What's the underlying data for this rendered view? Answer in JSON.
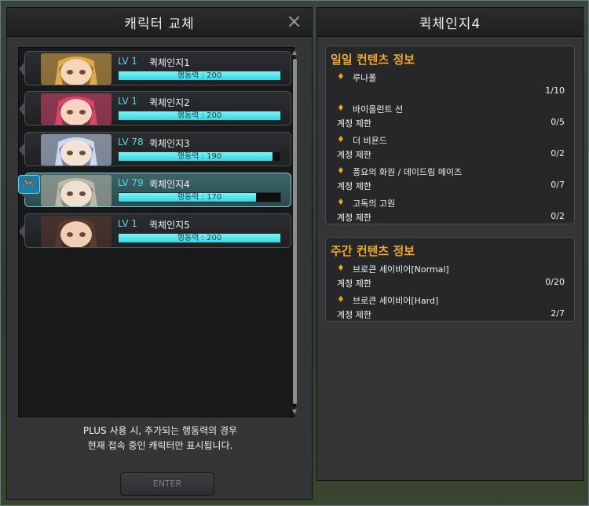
{
  "left_panel": {
    "title": "캐릭터 교체",
    "close_icon": "×",
    "characters": [
      {
        "level": "LV 1",
        "name": "퀵체인지1",
        "stamina": "행동력 : 200",
        "fill": 1.0,
        "hair": "#e0a94a",
        "skin": "#f5d6b8"
      },
      {
        "level": "LV 1",
        "name": "퀵체인지2",
        "stamina": "행동력 : 200",
        "fill": 1.0,
        "hair": "#d9446a",
        "skin": "#f7d4c0"
      },
      {
        "level": "LV 78",
        "name": "퀵체인지3",
        "stamina": "행동력 : 190",
        "fill": 0.95,
        "hair": "#c9d9f2",
        "skin": "#f3e2d6"
      },
      {
        "level": "LV 79",
        "name": "퀵체인지4",
        "stamina": "행동력 : 170",
        "fill": 0.85,
        "hair": "#bdb7a8",
        "skin": "#efe1d0"
      },
      {
        "level": "LV 1",
        "name": "퀵체인지5",
        "stamina": "행동력 : 200",
        "fill": 1.0,
        "hair": "#5a3a2c",
        "skin": "#f0cfb4"
      }
    ],
    "notice_line1": "PLUS 사용 시, 추가되는 행동력의 경우",
    "notice_line2": "현재 접속 중인 캐릭터만 표시됩니다.",
    "enter_label": "ENTER"
  },
  "right_panel": {
    "title": "퀵체인지4",
    "daily": {
      "title": "일일 컨텐츠 정보",
      "items": [
        {
          "name": "루나폴",
          "limit": "",
          "count": "1/10"
        },
        {
          "name": "바이올런트 선",
          "limit": "계정 제한",
          "count": "0/5"
        },
        {
          "name": "더 비욘드",
          "limit": "계정 제한",
          "count": "0/2"
        },
        {
          "name": "풍요의 화원 / 데이드림 메이즈",
          "limit": "계정 제한",
          "count": "0/7"
        },
        {
          "name": "고독의 고원",
          "limit": "계정 제한",
          "count": "0/2"
        }
      ]
    },
    "weekly": {
      "title": "주간 컨텐츠 정보",
      "items": [
        {
          "name": "브로큰 세이비어[Normal]",
          "limit": "계정 제한",
          "count": "0/20"
        },
        {
          "name": "브로큰 세이비어[Hard]",
          "limit": "계정 제한",
          "count": "2/7"
        }
      ]
    }
  },
  "colors": {
    "accent_cyan": "#5fd2e8",
    "section_title": "#f2a62a",
    "bar_fill": "#37d6e0"
  }
}
